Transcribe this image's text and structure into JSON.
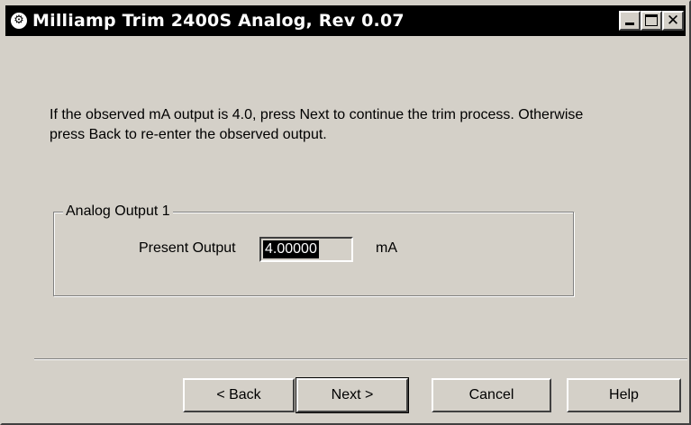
{
  "window": {
    "title": "Milliamp Trim 2400S Analog, Rev 0.07",
    "app_icon": "gear-icon",
    "controls": {
      "minimize": "minimize-icon",
      "maximize": "maximize-icon",
      "close_glyph": "✕"
    }
  },
  "instruction": {
    "text": "If the observed mA output is 4.0, press Next to continue the trim process.  Otherwise press Back to re-enter the observed output."
  },
  "group": {
    "label": "Analog Output 1",
    "output_label": "Present Output",
    "output_value": "4.00000",
    "unit": "mA"
  },
  "buttons": {
    "back": "< Back",
    "next": "Next >",
    "cancel": "Cancel",
    "help": "Help"
  },
  "colors": {
    "face": "#d4d0c8",
    "titlebar": "#000000",
    "title_text": "#ffffff",
    "selection": "#000000"
  }
}
